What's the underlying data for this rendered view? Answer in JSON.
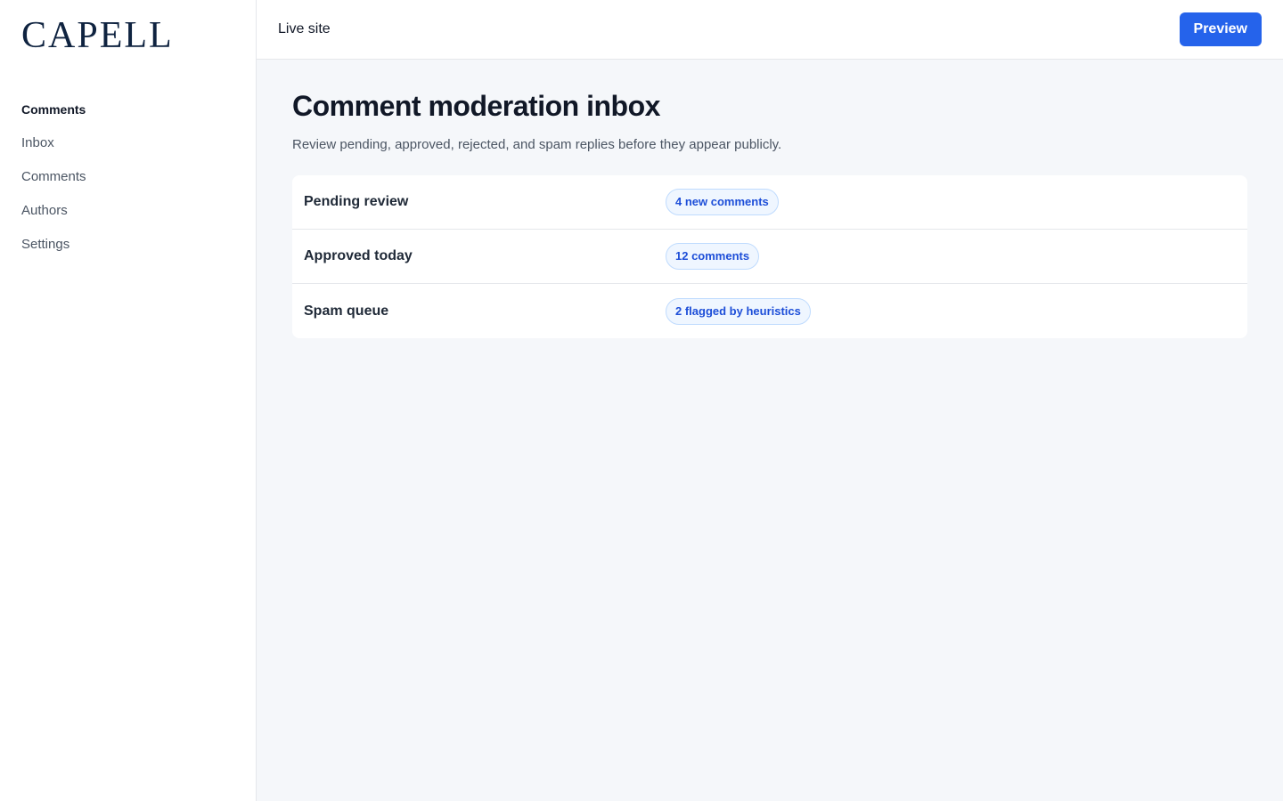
{
  "brand": {
    "logo_text": "CAPELL"
  },
  "sidebar": {
    "heading": "Comments",
    "items": [
      {
        "label": "Inbox"
      },
      {
        "label": "Comments"
      },
      {
        "label": "Authors"
      },
      {
        "label": "Settings"
      }
    ]
  },
  "topbar": {
    "live_site_label": "Live site",
    "preview_label": "Preview"
  },
  "page": {
    "title": "Comment moderation inbox",
    "subtitle": "Review pending, approved, rejected, and spam replies before they appear publicly."
  },
  "summary": {
    "rows": [
      {
        "label": "Pending review",
        "badge": "4 new comments"
      },
      {
        "label": "Approved today",
        "badge": "12 comments"
      },
      {
        "label": "Spam queue",
        "badge": "2 flagged by heuristics"
      }
    ]
  },
  "colors": {
    "accent": "#2563eb",
    "badge_text": "#1d4ed8",
    "badge_bg": "#eff6ff",
    "logo": "#0f2340"
  }
}
